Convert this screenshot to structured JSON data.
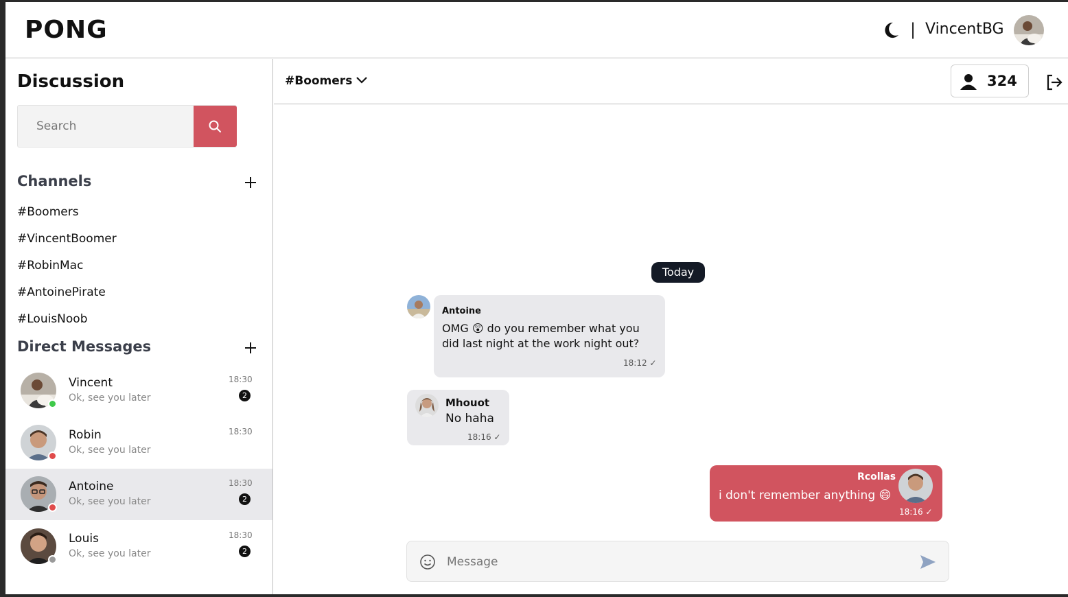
{
  "header": {
    "logo": "PONG",
    "separator": "|",
    "username": "VincentBG"
  },
  "sidebar": {
    "title": "Discussion",
    "search": {
      "placeholder": "Search"
    },
    "channels_title": "Channels",
    "channels": [
      "#Boomers",
      "#VincentBoomer",
      "#RobinMac",
      "#AntoinePirate",
      "#LouisNoob"
    ],
    "dm_title": "Direct Messages",
    "dms": [
      {
        "name": "Vincent",
        "message": "Ok, see you later",
        "time": "18:30",
        "badge": "2",
        "status": "online",
        "status_color": "#3fc94a",
        "active": false
      },
      {
        "name": "Robin",
        "message": "Ok, see you later",
        "time": "18:30",
        "badge": "",
        "status": "busy",
        "status_color": "#e04b4b",
        "active": false
      },
      {
        "name": "Antoine",
        "message": "Ok, see you later",
        "time": "18:30",
        "badge": "2",
        "status": "busy",
        "status_color": "#e04b4b",
        "active": true
      },
      {
        "name": "Louis",
        "message": "Ok, see you later",
        "time": "18:30",
        "badge": "2",
        "status": "offline",
        "status_color": "#9a9a9a",
        "active": false
      }
    ]
  },
  "chat": {
    "channel": "#Boomers",
    "member_count": "324",
    "date_divider": "Today",
    "messages": [
      {
        "author": "Antoine",
        "lines": [
          "OMG 😲 do you remember what you",
          "did last night at the work night out?"
        ],
        "time": "18:12 ✓",
        "direction": "in"
      },
      {
        "author": "Mhouot",
        "lines": [
          "No haha"
        ],
        "time": "18:16 ✓",
        "direction": "in"
      },
      {
        "author": "Rcollas",
        "lines": [
          "i don't remember anything 😄"
        ],
        "time": "18:16 ✓",
        "direction": "out"
      }
    ],
    "composer": {
      "placeholder": "Message"
    }
  },
  "colors": {
    "accent": "#d1545f",
    "dark": "#141a26",
    "bubble_in": "#e9e9ec",
    "active_row": "#e9e9ec"
  },
  "icons": [
    "moon-icon",
    "search-icon",
    "plus-icon",
    "chevron-down-icon",
    "user-icon",
    "logout-icon",
    "emoji-icon",
    "send-icon"
  ]
}
